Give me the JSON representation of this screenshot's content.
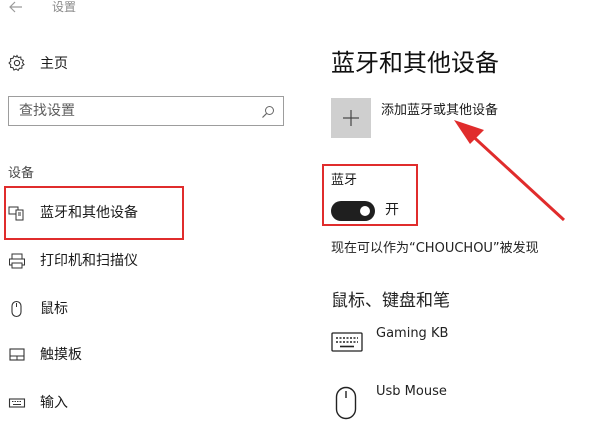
{
  "window": {
    "back_icon": "arrow-left-icon",
    "title": "设置"
  },
  "sidebar": {
    "home": {
      "icon": "gear-icon",
      "label": "主页"
    },
    "search": {
      "placeholder": "查找设置",
      "icon": "search-icon"
    },
    "section_label": "设备",
    "items": [
      {
        "icon": "bluetooth-devices-icon",
        "label": "蓝牙和其他设备",
        "selected": true
      },
      {
        "icon": "printer-icon",
        "label": "打印机和扫描仪"
      },
      {
        "icon": "mouse-icon",
        "label": "鼠标"
      },
      {
        "icon": "touchpad-icon",
        "label": "触摸板"
      },
      {
        "icon": "keyboard-icon",
        "label": "输入"
      }
    ]
  },
  "main": {
    "title": "蓝牙和其他设备",
    "add_device": {
      "icon": "plus-icon",
      "label": "添加蓝牙或其他设备"
    },
    "bluetooth": {
      "heading": "蓝牙",
      "toggle_state": "on",
      "toggle_label": "开"
    },
    "discoverable_text": "现在可以作为“CHOUCHOU”被发现",
    "section_heading": "鼠标、键盘和笔",
    "devices": [
      {
        "icon": "keyboard-icon",
        "name": "Gaming KB"
      },
      {
        "icon": "mouse-icon",
        "name": "Usb Mouse"
      }
    ]
  },
  "colors": {
    "annotation_red": "#e02c2c",
    "toggle_on": "#1f1f1f",
    "tile_gray": "#cfcfcf"
  }
}
